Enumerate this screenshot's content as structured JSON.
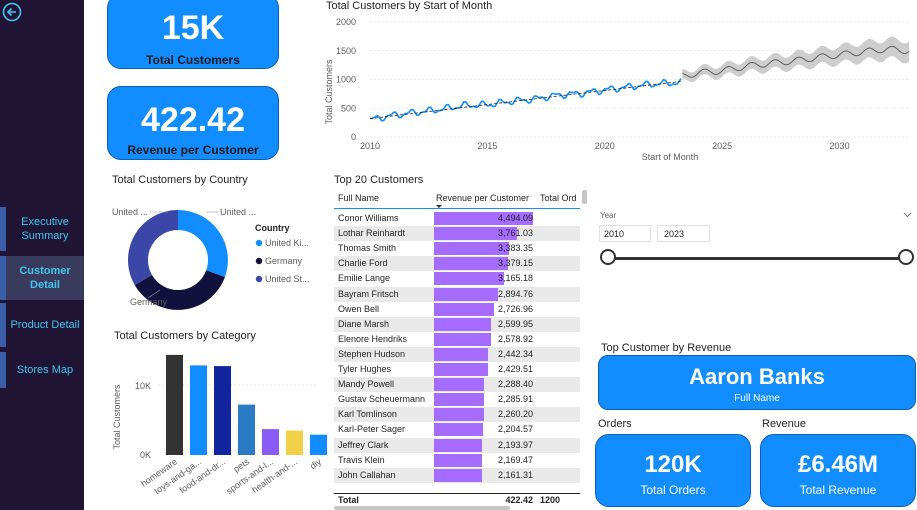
{
  "nav": {
    "items": [
      {
        "label": "Executive Summary"
      },
      {
        "label": "Customer Detail"
      },
      {
        "label": "Product Detail"
      },
      {
        "label": "Stores Map"
      }
    ]
  },
  "kpi_total_customers": {
    "value": "15K",
    "label": "Total Customers"
  },
  "kpi_revenue_per_customer": {
    "value": "422.42",
    "label": "Revenue per Customer"
  },
  "line_chart": {
    "title": "Total Customers by Start of Month",
    "xlabel": "Start of Month",
    "ylabel": "Total Customers",
    "y_ticks": [
      "2000",
      "1500",
      "1000",
      "500",
      "0"
    ],
    "x_ticks": [
      "2010",
      "2015",
      "2020",
      "2025",
      "2030"
    ]
  },
  "donut": {
    "title": "Total Customers by Country",
    "legend_title": "Country",
    "labels": [
      "United ...",
      "United ...",
      "Germany"
    ],
    "legend": [
      {
        "label": "United Ki...",
        "color": "#118dff"
      },
      {
        "label": "Germany",
        "color": "#12239e"
      },
      {
        "label": "United St...",
        "color": "#3b47a6"
      }
    ]
  },
  "bar_chart": {
    "title": "Total Customers by Category",
    "ylabel": "Total Customers",
    "y_ticks": [
      "10K",
      "0K"
    ]
  },
  "table": {
    "title": "Top 20 Customers",
    "headers": [
      "Full Name",
      "Revenue per Customer",
      "Total Ord"
    ],
    "rows": [
      {
        "name": "Conor Williams",
        "value": "4,494.09"
      },
      {
        "name": "Lothar Reinhardt",
        "value": "3,761.03"
      },
      {
        "name": "Thomas Smith",
        "value": "3,383.35"
      },
      {
        "name": "Charlie Ford",
        "value": "3,379.15"
      },
      {
        "name": "Emilie Lange",
        "value": "3,165.18"
      },
      {
        "name": "Bayram Fritsch",
        "value": "2,894.76"
      },
      {
        "name": "Owen Bell",
        "value": "2,726.96"
      },
      {
        "name": "Diane Marsh",
        "value": "2,599.95"
      },
      {
        "name": "Elenore Hendriks",
        "value": "2,578.92"
      },
      {
        "name": "Stephen Hudson",
        "value": "2,442.34"
      },
      {
        "name": "Tyler Hughes",
        "value": "2,429.51"
      },
      {
        "name": "Mandy Powell",
        "value": "2,288.40"
      },
      {
        "name": "Gustav Scheuermann",
        "value": "2,285.91"
      },
      {
        "name": "Karl Tomlinson",
        "value": "2,260.20"
      },
      {
        "name": "Karl-Peter Sager",
        "value": "2,204.57"
      },
      {
        "name": "Jeffrey Clark",
        "value": "2,193.97"
      },
      {
        "name": "Travis Klein",
        "value": "2,169.47"
      },
      {
        "name": "John Callahan",
        "value": "2,161.31"
      }
    ],
    "total_label": "Total",
    "total_value": "422.42",
    "total_orders": "1200"
  },
  "slicer": {
    "label": "Year",
    "start": "2010",
    "end": "2023"
  },
  "top_customer": {
    "title": "Top Customer by Revenue",
    "name": "Aaron Banks",
    "sublabel": "Full Name"
  },
  "orders_card": {
    "title": "Orders",
    "value": "120K",
    "label": "Total Orders"
  },
  "revenue_card": {
    "title": "Revenue",
    "value": "£6.46M",
    "label": "Total Revenue"
  },
  "chart_data": [
    {
      "type": "line",
      "title": "Total Customers by Start of Month",
      "xlabel": "Start of Month",
      "ylabel": "Total Customers",
      "xlim": [
        2010,
        2033
      ],
      "ylim": [
        0,
        2000
      ],
      "series": [
        {
          "name": "actual",
          "x": [
            2010,
            2011,
            2012,
            2013,
            2014,
            2015,
            2016,
            2017,
            2018,
            2019,
            2020,
            2021,
            2022,
            2023.3
          ],
          "y": [
            300,
            380,
            430,
            480,
            550,
            560,
            620,
            660,
            730,
            760,
            820,
            870,
            920,
            950
          ],
          "color": "#118dff"
        },
        {
          "name": "forecast",
          "x": [
            2023.3,
            2024,
            2025,
            2026,
            2027,
            2028,
            2029,
            2030,
            2031,
            2032,
            2033
          ],
          "y": [
            1050,
            1120,
            1150,
            1230,
            1280,
            1320,
            1380,
            1430,
            1480,
            1530,
            1500
          ],
          "color": "#555555"
        }
      ]
    },
    {
      "type": "pie",
      "title": "Total Customers by Country",
      "categories": [
        "United Kingdom",
        "Germany",
        "United States"
      ],
      "values": [
        35,
        30,
        35
      ]
    },
    {
      "type": "bar",
      "title": "Total Customers by Category",
      "ylabel": "Total Customers",
      "categories": [
        "homeware",
        "toys-and-ga...",
        "food-and-dr...",
        "pets",
        "sports-and-l...",
        "health-and-...",
        "diy"
      ],
      "values": [
        14300,
        12800,
        12700,
        7200,
        3700,
        3500,
        2900
      ],
      "colors": [
        "#333333",
        "#118dff",
        "#12239e",
        "#2b7bc4",
        "#8a5cf6",
        "#f2d14a",
        "#118dff"
      ],
      "ylim": [
        0,
        15000
      ]
    }
  ]
}
